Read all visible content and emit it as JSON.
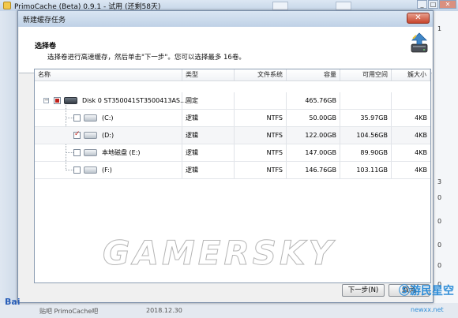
{
  "app": {
    "title": "PrimoCache (Beta) 0.9.1 - 试用 (还剩58天)"
  },
  "background": {
    "right_numbers": [
      "1",
      "3",
      "0",
      "0",
      "0",
      "0",
      "0"
    ],
    "status_items": [
      "Bai",
      "贴吧 PrimoCache吧",
      "2018.12.30"
    ]
  },
  "dialog": {
    "title": "新建缓存任务",
    "close_glyph": "✕",
    "header_title": "选择卷",
    "header_subtitle": "选择卷进行高速缓存，然后单击\"下一步\"。您可以选择最多 16卷。",
    "columns": [
      "名称",
      "类型",
      "文件系统",
      "容量",
      "可用空间",
      "簇大小"
    ],
    "disk": {
      "name": "Disk 0 ST350041ST3500413AS...",
      "type": "固定",
      "capacity": "465.76GB",
      "checked": "partial",
      "expand": "−"
    },
    "volumes": [
      {
        "name": "(C:)",
        "type": "逻辑",
        "fs": "NTFS",
        "capacity": "50.00GB",
        "free": "35.97GB",
        "cluster": "4KB",
        "checked": false
      },
      {
        "name": "(D:)",
        "type": "逻辑",
        "fs": "NTFS",
        "capacity": "122.00GB",
        "free": "104.56GB",
        "cluster": "4KB",
        "checked": true
      },
      {
        "name": "本地磁盘 (E:)",
        "type": "逻辑",
        "fs": "NTFS",
        "capacity": "147.00GB",
        "free": "89.90GB",
        "cluster": "4KB",
        "checked": false
      },
      {
        "name": "(F:)",
        "type": "逻辑",
        "fs": "NTFS",
        "capacity": "146.76GB",
        "free": "103.11GB",
        "cluster": "4KB",
        "checked": false
      }
    ],
    "buttons": {
      "next": "下一步(N)",
      "cancel": "取消"
    }
  },
  "watermarks": {
    "center": "GAMERSKY",
    "site_cn": "Ⓢ游民星空",
    "site_url": "newxx.net"
  },
  "colors": {
    "accent_red": "#c0201a",
    "title_blue": "#bfd1e6"
  }
}
